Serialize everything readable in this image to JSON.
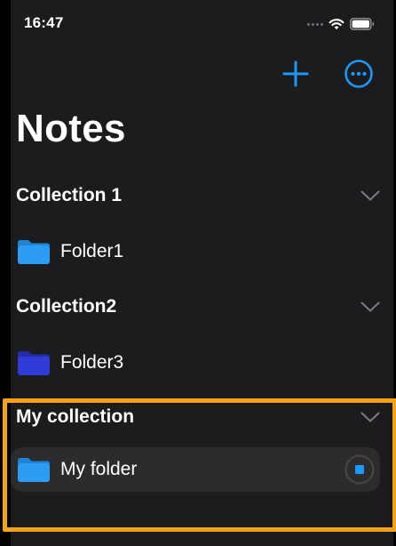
{
  "status_bar": {
    "time": "16:47"
  },
  "toolbar": {
    "add_icon": "plus-icon",
    "more_icon": "ellipsis-circle-icon"
  },
  "page": {
    "title": "Notes"
  },
  "collections": [
    {
      "title": "Collection 1",
      "folders": [
        {
          "label": "Folder1",
          "color": "#2c9cf5"
        }
      ]
    },
    {
      "title": "Collection2",
      "folders": [
        {
          "label": "Folder3",
          "color": "#2f3bd6"
        }
      ]
    },
    {
      "title": "My collection",
      "folders": [
        {
          "label": "My folder",
          "color": "#2c9cf5",
          "selected": true
        }
      ]
    }
  ],
  "colors": {
    "accent": "#1a9bfc",
    "background": "#1c1c1e",
    "selected_row": "#2c2c2e",
    "highlight": "#f5a214"
  }
}
